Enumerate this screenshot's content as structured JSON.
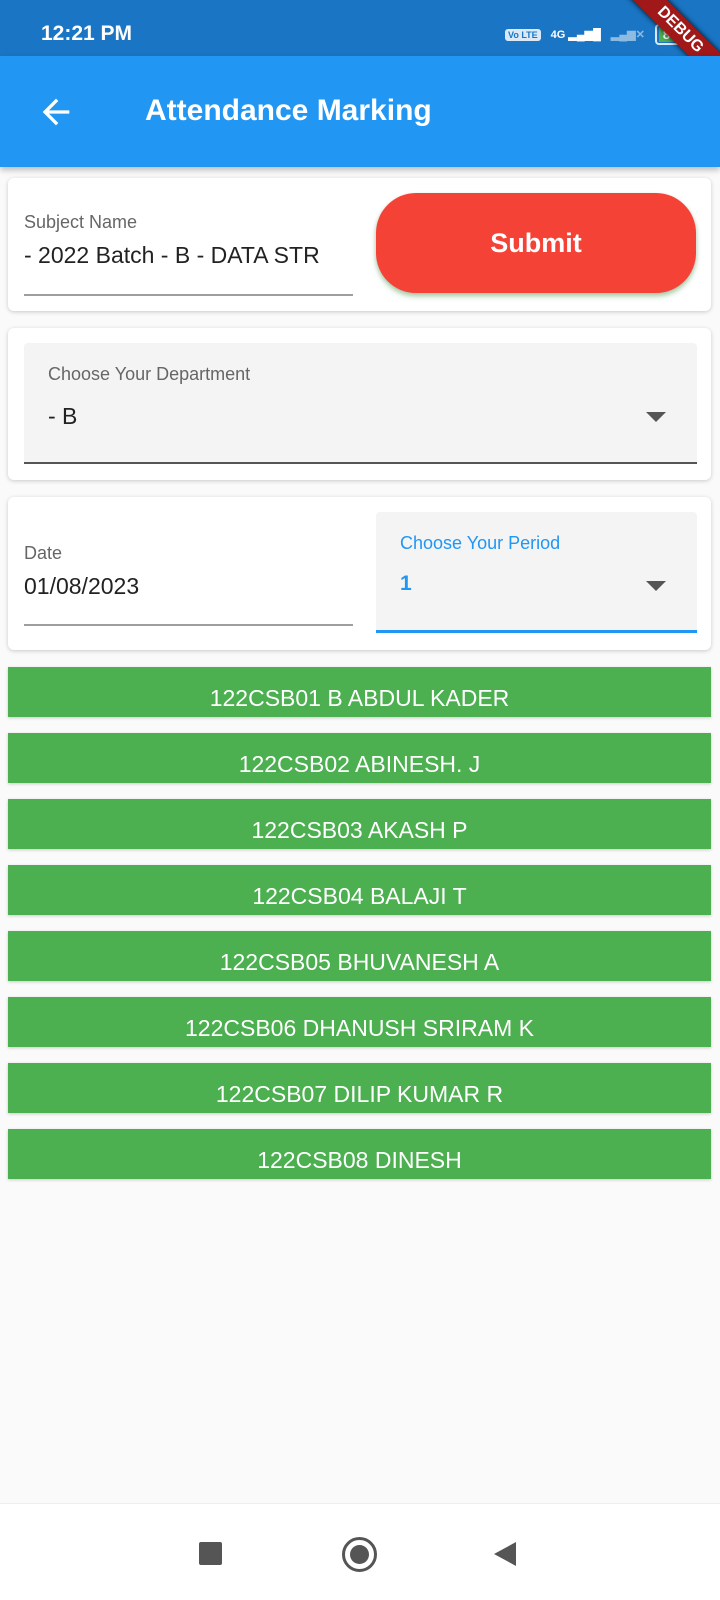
{
  "status_bar": {
    "time": "12:21 PM",
    "volte": "Vo LTE",
    "network": "4G",
    "battery": "85",
    "debug_banner": "DEBUG"
  },
  "app_bar": {
    "title": "Attendance Marking",
    "back_icon": "arrow-back-icon"
  },
  "subject": {
    "label": "Subject Name",
    "value": " - 2022 Batch - B - DATA STR"
  },
  "submit_label": "Submit",
  "department": {
    "label": "Choose Your Department",
    "value": " - B"
  },
  "date": {
    "label": "Date",
    "value": "01/08/2023"
  },
  "period": {
    "label": "Choose Your Period",
    "value": "1"
  },
  "students": [
    "122CSB01 B ABDUL KADER",
    "122CSB02 ABINESH. J",
    "122CSB03 AKASH P",
    "122CSB04 BALAJI T",
    "122CSB05 BHUVANESH A",
    "122CSB06 DHANUSH SRIRAM K",
    "122CSB07 DILIP KUMAR R",
    "122CSB08 DINESH"
  ],
  "colors": {
    "app_bar": "#2196f3",
    "submit": "#f44336",
    "student_row": "#4caf50",
    "focus": "#2196f3"
  }
}
